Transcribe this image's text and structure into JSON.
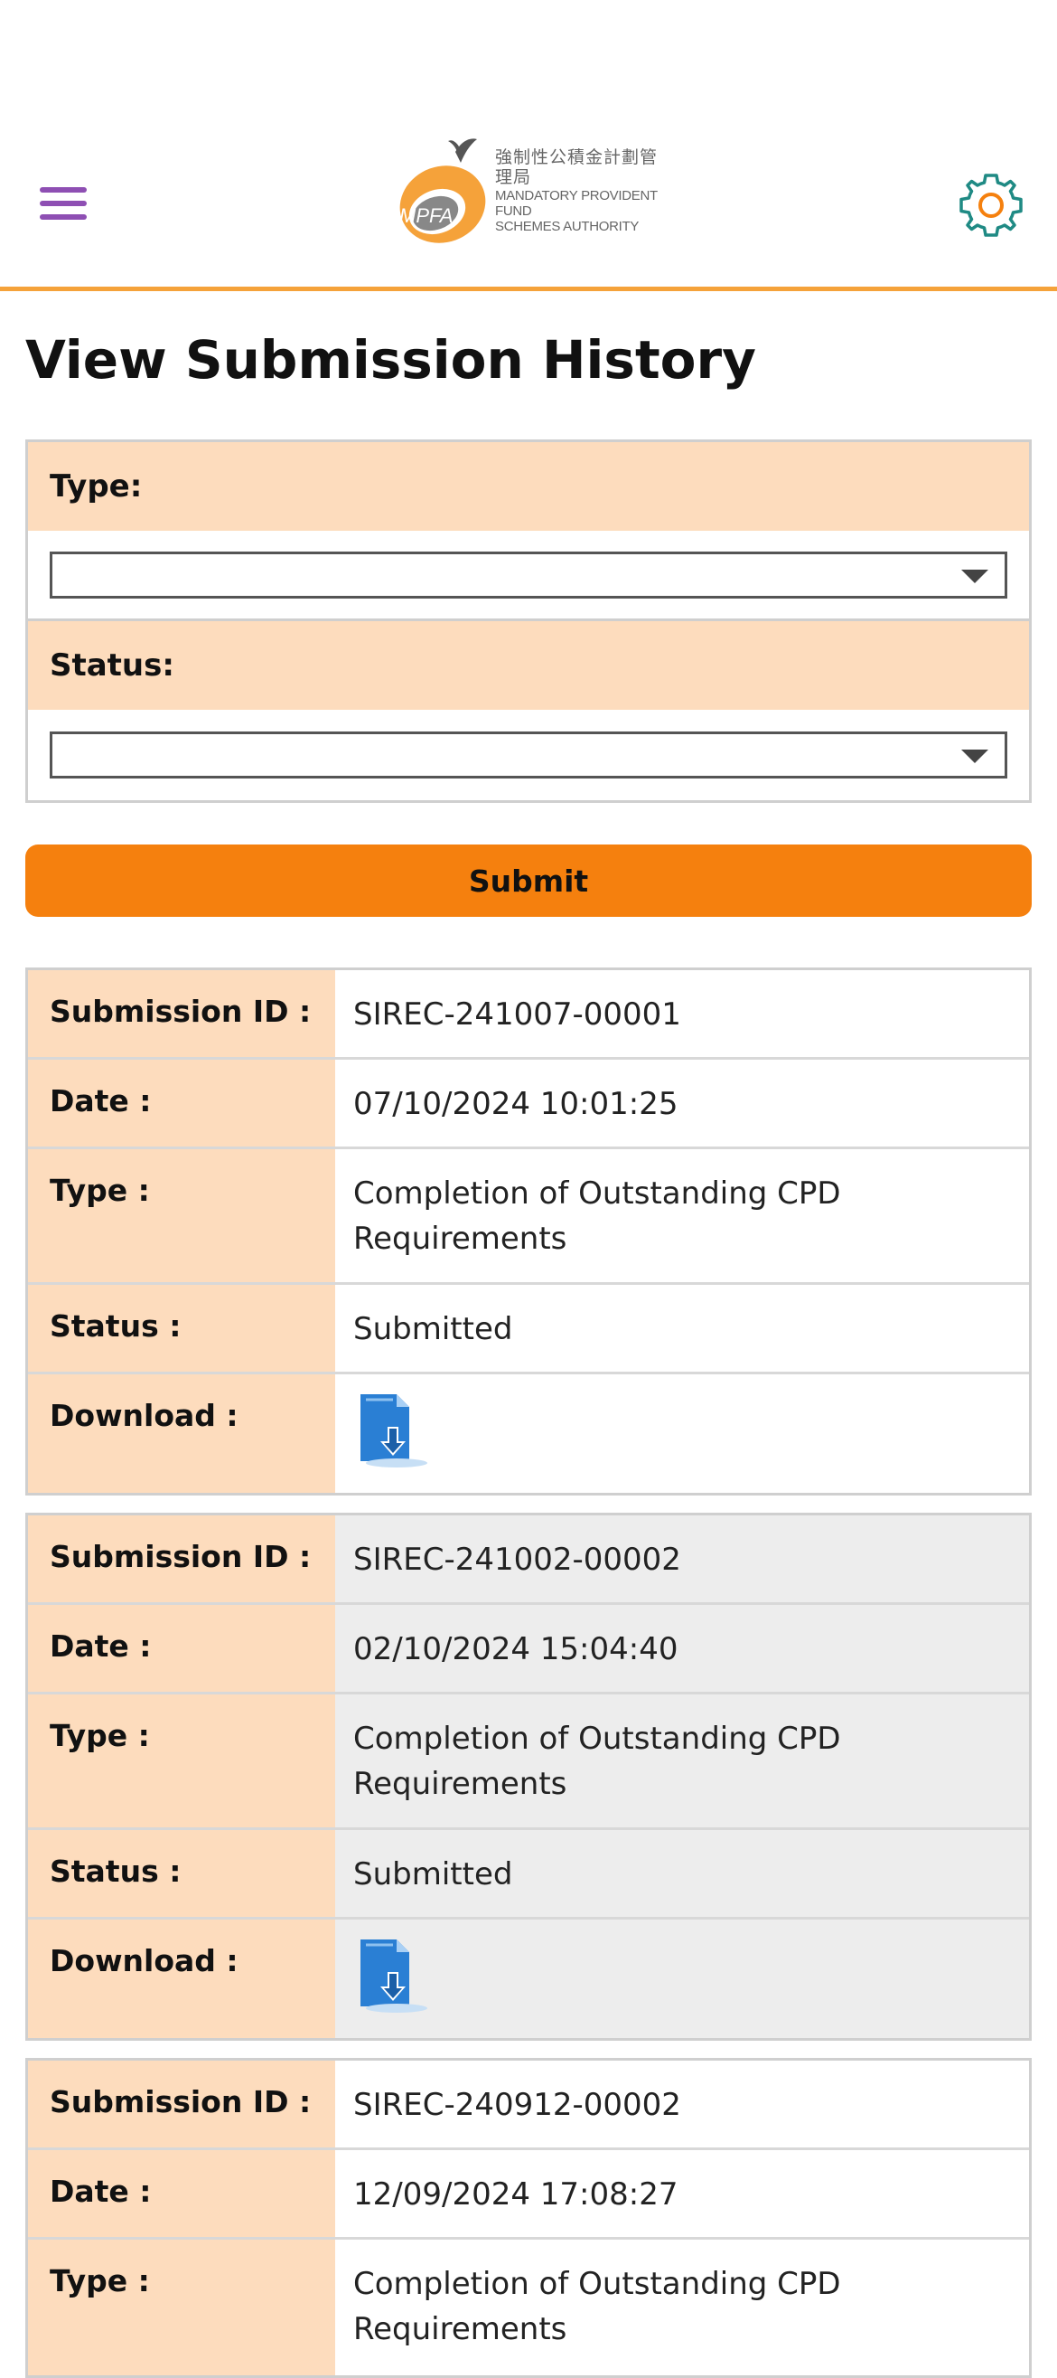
{
  "header": {
    "logo": {
      "chinese": "強制性公積金計劃管理局",
      "english_line1": "MANDATORY PROVIDENT FUND",
      "english_line2": "SCHEMES AUTHORITY",
      "mark": "MPFA"
    },
    "menu_icon": "hamburger-icon",
    "settings_icon": "gear-icon",
    "accent_color": "#f5a23a"
  },
  "page_title": "View Submission History",
  "filters": {
    "type_label": "Type:",
    "type_value": "",
    "status_label": "Status:",
    "status_value": ""
  },
  "submit_label": "Submit",
  "colors": {
    "label_bg": "#fddcbd",
    "button_bg": "#f5800e"
  },
  "records": [
    {
      "id_label": "Submission ID :",
      "id": "SIREC-241007-00001",
      "date_label": "Date :",
      "date": "07/10/2024 10:01:25",
      "type_label": "Type :",
      "type": "Completion of Outstanding CPD Requirements",
      "status_label": "Status :",
      "status": "Submitted",
      "download_label": "Download :"
    },
    {
      "id_label": "Submission ID :",
      "id": "SIREC-241002-00002",
      "date_label": "Date :",
      "date": "02/10/2024 15:04:40",
      "type_label": "Type :",
      "type": "Completion of Outstanding CPD Requirements",
      "status_label": "Status :",
      "status": "Submitted",
      "download_label": "Download :"
    },
    {
      "id_label": "Submission ID :",
      "id": "SIREC-240912-00002",
      "date_label": "Date :",
      "date": "12/09/2024 17:08:27",
      "type_label": "Type :",
      "type": "Completion of Outstanding CPD Requirements"
    }
  ]
}
